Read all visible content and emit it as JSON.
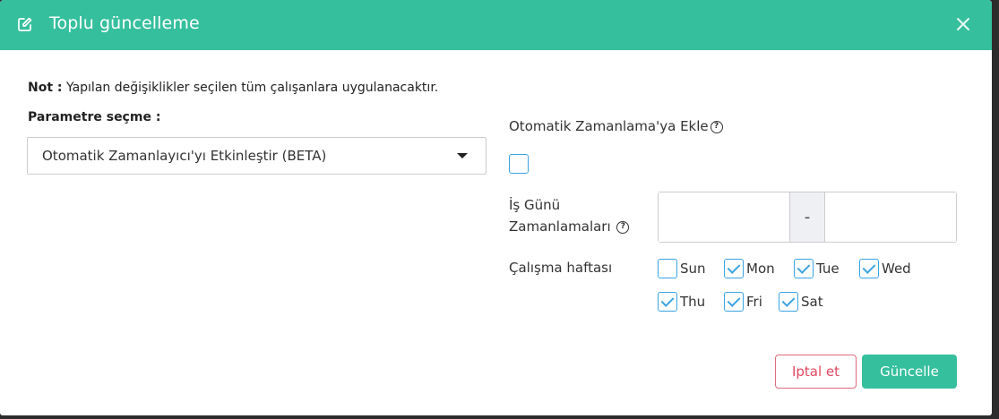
{
  "header": {
    "title": "Toplu güncelleme",
    "edit_icon": "edit-icon",
    "close_icon": "close-icon"
  },
  "note": {
    "prefix": "Not :",
    "text": " Yapılan değişiklikler seçilen tüm çalışanlara uygulanacaktır."
  },
  "parameter": {
    "label": "Parametre seçme :",
    "selected": "Otomatik Zamanlayıcı'yı Etkinleştir (BETA)"
  },
  "auto_schedule": {
    "label": "Otomatik Zamanlama'ya Ekle",
    "help": "?",
    "checked": false
  },
  "work_day": {
    "label": "İş Günü Zamanlamaları",
    "help": "?",
    "separator": "-",
    "start": "",
    "end": ""
  },
  "work_week": {
    "label": "Çalışma haftası",
    "days": [
      {
        "label": "Sun",
        "checked": false
      },
      {
        "label": "Mon",
        "checked": true
      },
      {
        "label": "Tue",
        "checked": true
      },
      {
        "label": "Wed",
        "checked": true
      },
      {
        "label": "Thu",
        "checked": true
      },
      {
        "label": "Fri",
        "checked": true
      },
      {
        "label": "Sat",
        "checked": true
      }
    ]
  },
  "buttons": {
    "cancel": "Iptal et",
    "update": "Güncelle"
  },
  "colors": {
    "accent": "#36bf9d",
    "checkbox": "#3aa3e3",
    "cancel": "#e0485f"
  }
}
